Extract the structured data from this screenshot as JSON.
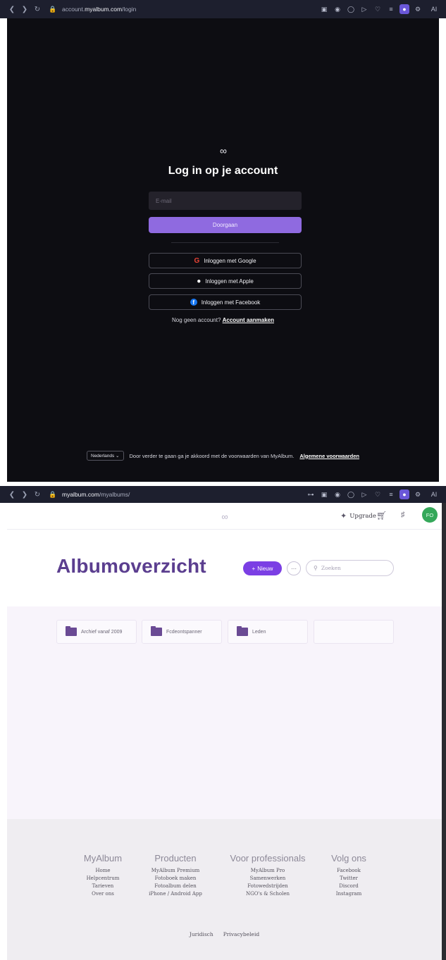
{
  "login_browser": {
    "url_prefix": "account.",
    "url_domain": "myalbum.com",
    "url_path": "/login",
    "ai_label": "AI"
  },
  "login": {
    "title": "Log in op je account",
    "email_placeholder": "E-mail",
    "continue_label": "Doorgaan",
    "google_label": "Inloggen met Google",
    "apple_label": "Inloggen met Apple",
    "facebook_label": "Inloggen met Facebook",
    "no_account_text": "Nog geen account?",
    "create_account_link": "Account aanmaken",
    "language": "Nederlands",
    "terms_text": "Door verder te gaan ga je akkoord met de voorwaarden van MyAlbum.",
    "terms_link": "Algemene voorwaarden"
  },
  "album_browser": {
    "url_domain": "myalbum.com",
    "url_path": "/myalbums/",
    "ai_label": "AI"
  },
  "header": {
    "upgrade_label": "Upgrade",
    "avatar_initials": "FO"
  },
  "albums": {
    "title": "Albumoverzicht",
    "new_label": "Nieuw",
    "search_placeholder": "Zoeken",
    "folders": [
      {
        "name": "Archief vanaf 2009"
      },
      {
        "name": "Fcdeontspanner"
      },
      {
        "name": "Leden"
      }
    ]
  },
  "footer": {
    "columns": [
      {
        "heading": "MyAlbum",
        "links": [
          "Home",
          "Helpcentrum",
          "Tarieven",
          "Over ons"
        ]
      },
      {
        "heading": "Producten",
        "links": [
          "MyAlbum Premium",
          "Fotoboek maken",
          "Fotoalbum delen",
          "iPhone / Android App"
        ]
      },
      {
        "heading": "Voor professionals",
        "links": [
          "MyAlbum Pro",
          "Samenwerken",
          "Fotowedstrijden",
          "NGO's & Scholen"
        ]
      },
      {
        "heading": "Volg ons",
        "links": [
          "Facebook",
          "Twitter",
          "Discord",
          "Instagram"
        ]
      }
    ],
    "legal": [
      "Juridisch",
      "Privacybeleid"
    ]
  }
}
